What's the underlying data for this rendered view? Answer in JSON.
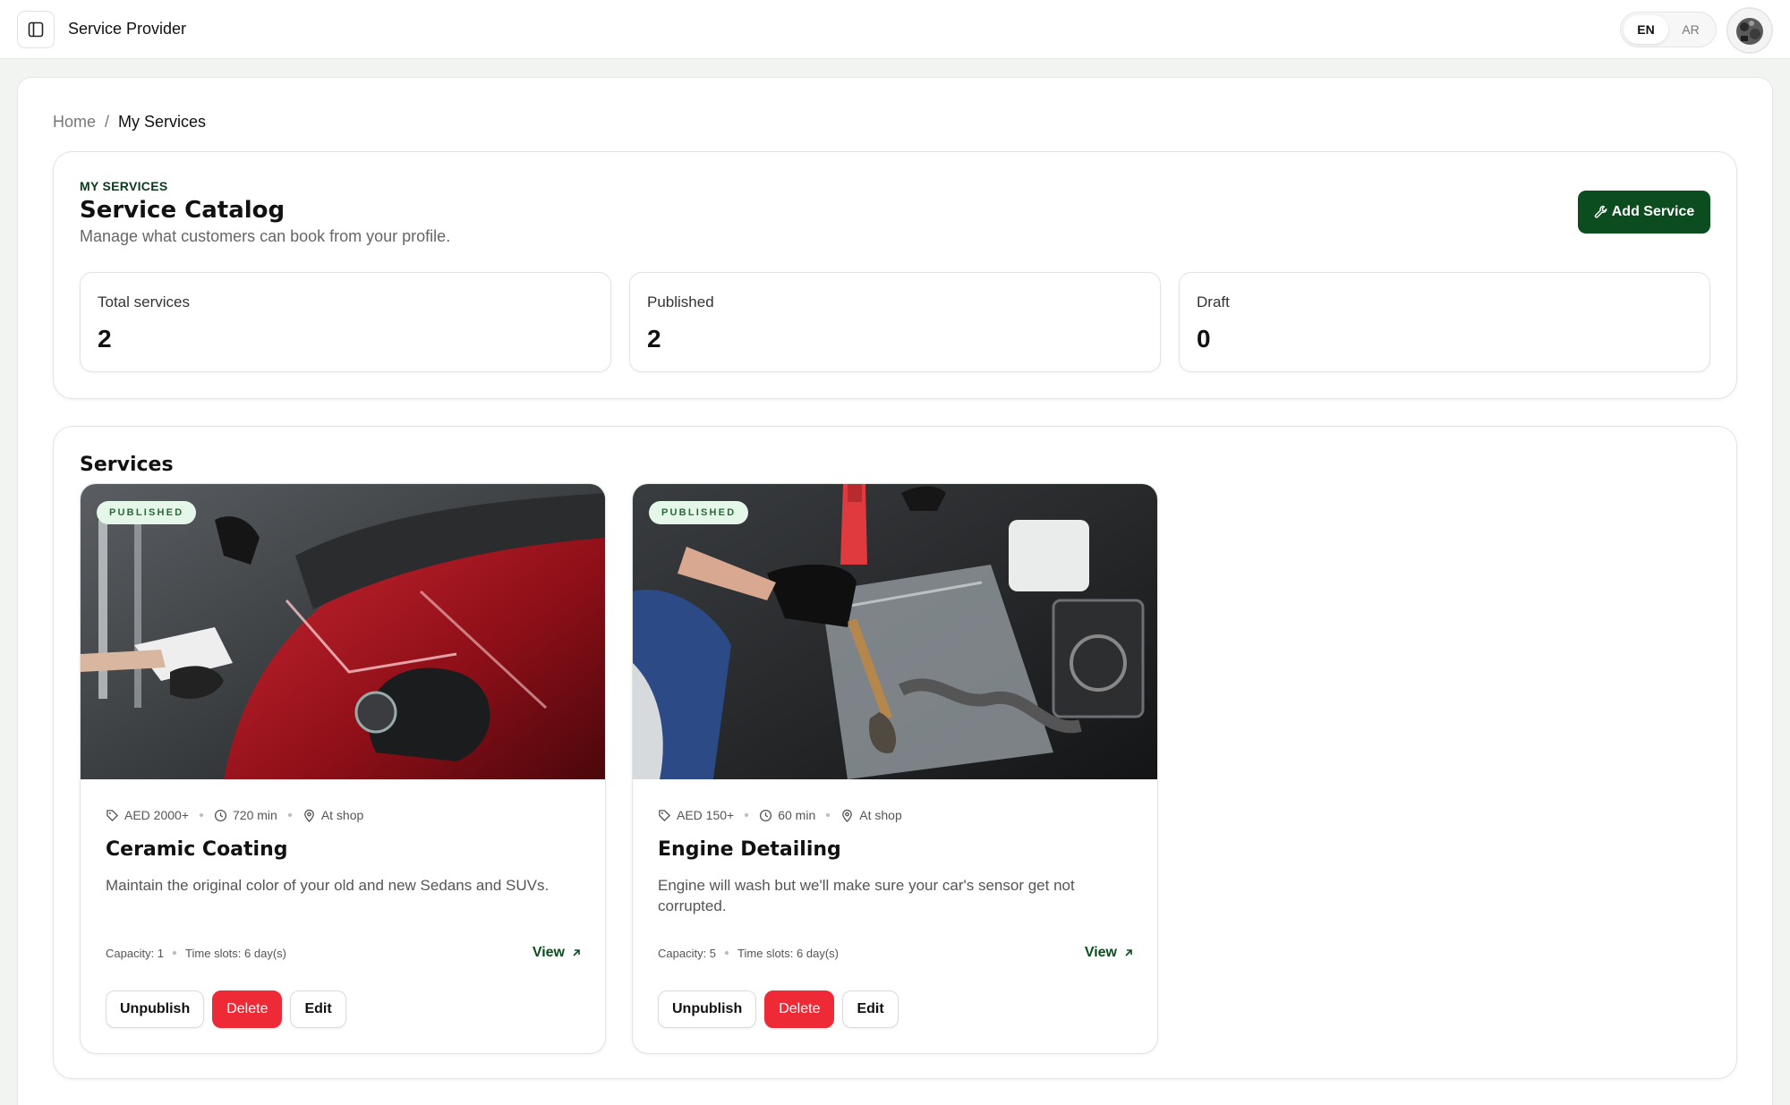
{
  "app": {
    "title": "Service Provider"
  },
  "language": {
    "options": [
      "EN",
      "AR"
    ],
    "selected": "EN"
  },
  "breadcrumb": {
    "home": "Home",
    "separator": "/",
    "current": "My Services"
  },
  "header": {
    "eyebrow": "MY SERVICES",
    "title": "Service Catalog",
    "subtitle": "Manage what customers can book from your profile.",
    "add_button": "Add Service"
  },
  "stats": [
    {
      "label": "Total services",
      "value": "2"
    },
    {
      "label": "Published",
      "value": "2"
    },
    {
      "label": "Draft",
      "value": "0"
    }
  ],
  "services_section": {
    "title": "Services"
  },
  "services": [
    {
      "status": "PUBLISHED",
      "price": "AED 2000+",
      "duration": "720 min",
      "location": "At shop",
      "name": "Ceramic Coating",
      "description": "Maintain the original color of your old and new Sedans and SUVs.",
      "capacity": "Capacity: 1",
      "time_slots": "Time slots: 6 day(s)",
      "view": "View",
      "actions": [
        "Unpublish",
        "Delete",
        "Edit"
      ]
    },
    {
      "status": "PUBLISHED",
      "price": "AED 150+",
      "duration": "60 min",
      "location": "At shop",
      "name": "Engine Detailing",
      "description": "Engine will wash but we'll make sure your car's sensor get not corrupted.",
      "capacity": "Capacity: 5",
      "time_slots": "Time slots: 6 day(s)",
      "view": "View",
      "actions": [
        "Unpublish",
        "Delete",
        "Edit"
      ]
    }
  ],
  "colors": {
    "brand": "#0b4d1f",
    "danger": "#ee2a36",
    "badge_bg": "#e4f7e8"
  },
  "icons": [
    "sidebar-toggle-icon",
    "wrench-icon",
    "tag-icon",
    "clock-icon",
    "pin-icon",
    "arrow-up-right-icon"
  ]
}
